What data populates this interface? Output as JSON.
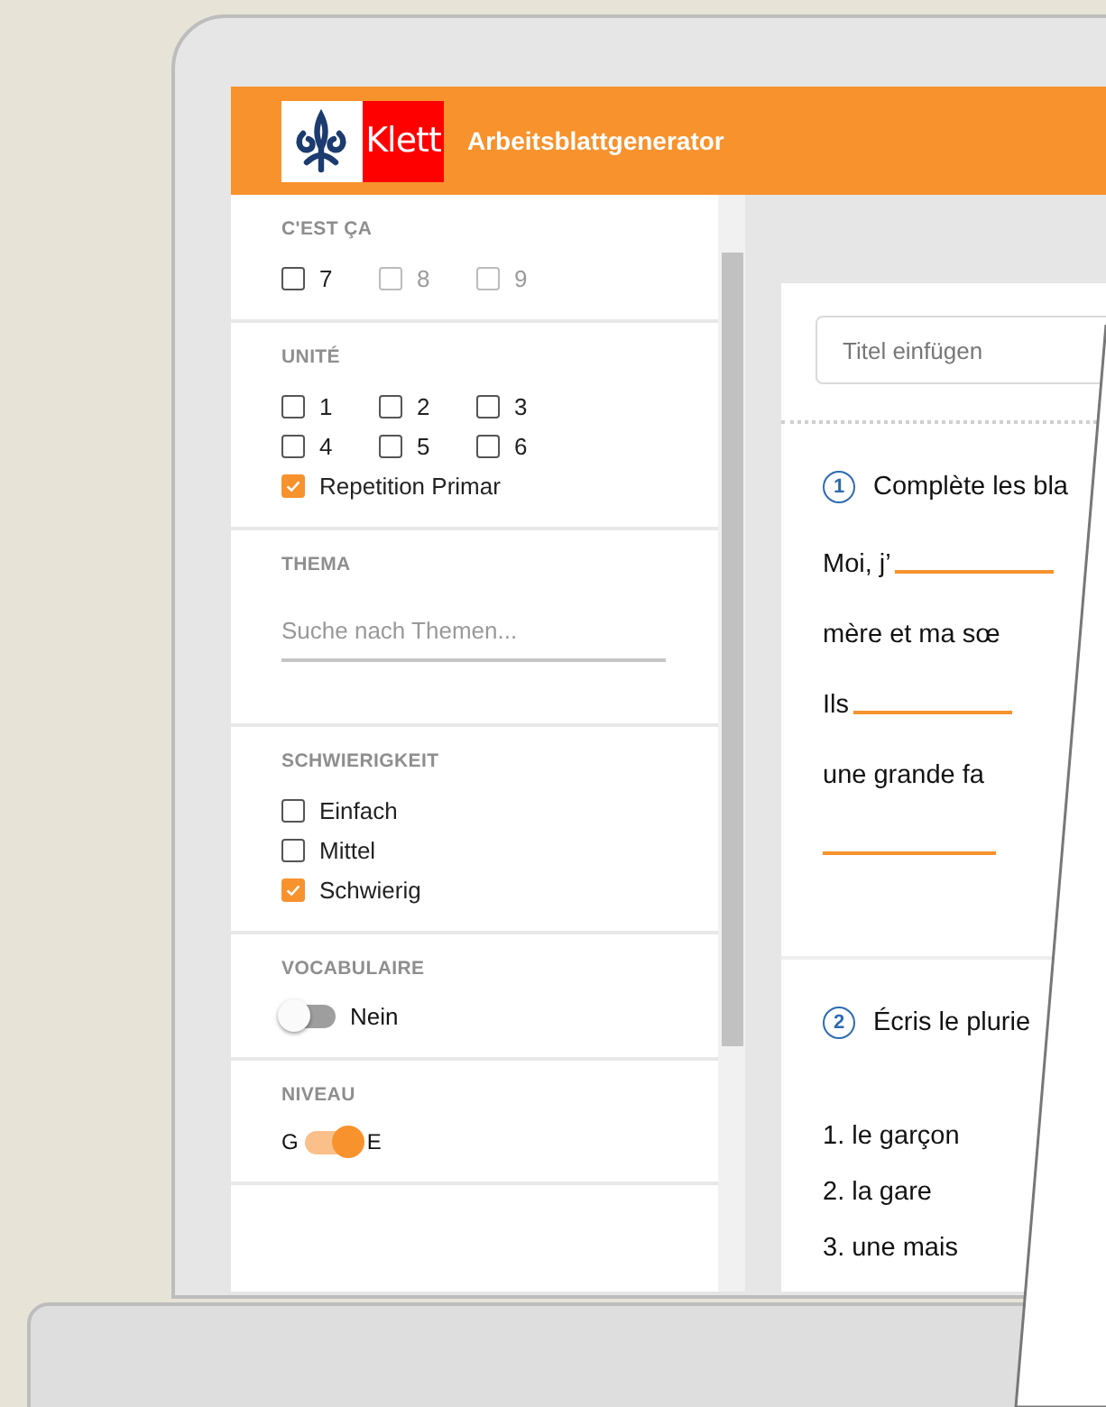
{
  "header": {
    "logo_text": "Klett",
    "title": "Arbeitsblattgenerator"
  },
  "sidebar": {
    "sections": [
      {
        "kind": "checkboxes",
        "heading": "C'EST ÇA",
        "items": [
          {
            "label": "7",
            "checked": false,
            "disabled": false
          },
          {
            "label": "8",
            "checked": false,
            "disabled": true
          },
          {
            "label": "9",
            "checked": false,
            "disabled": true
          }
        ]
      },
      {
        "kind": "checkboxes",
        "heading": "UNITÉ",
        "items": [
          {
            "label": "1",
            "checked": false,
            "disabled": false
          },
          {
            "label": "2",
            "checked": false,
            "disabled": false
          },
          {
            "label": "3",
            "checked": false,
            "disabled": false
          },
          {
            "label": "4",
            "checked": false,
            "disabled": false
          },
          {
            "label": "5",
            "checked": false,
            "disabled": false
          },
          {
            "label": "6",
            "checked": false,
            "disabled": false
          },
          {
            "label": "Repetition Primar",
            "checked": true,
            "disabled": false
          }
        ]
      },
      {
        "kind": "search",
        "heading": "THEMA",
        "placeholder": "Suche nach Themen..."
      },
      {
        "kind": "list",
        "heading": "SCHWIERIGKEIT",
        "items": [
          {
            "label": "Einfach",
            "checked": false,
            "disabled": false
          },
          {
            "label": "Mittel",
            "checked": false,
            "disabled": false
          },
          {
            "label": "Schwierig",
            "checked": true,
            "disabled": false
          }
        ]
      },
      {
        "kind": "toggle",
        "heading": "VOCABULAIRE",
        "on": false,
        "label": "Nein"
      },
      {
        "kind": "switch",
        "heading": "NIVEAU",
        "on": true,
        "left_label": "G",
        "right_label": "E"
      }
    ]
  },
  "worksheet": {
    "title_field": {
      "placeholder": "Titel einfügen"
    },
    "exercises": [
      {
        "number": "1",
        "instruction": "Complète les bla",
        "lines": [
          {
            "text": "Moi, j’",
            "blank": true
          },
          {
            "text": "mère et ma sœ",
            "blank": false
          },
          {
            "text": "Ils",
            "blank": true
          },
          {
            "text": "une grande fa",
            "blank": false
          },
          {
            "blank": true
          }
        ]
      },
      {
        "number": "2",
        "instruction": "Écris le plurie",
        "items": [
          "1. le garçon",
          "2. la gare",
          "3. une mais"
        ]
      }
    ]
  }
}
